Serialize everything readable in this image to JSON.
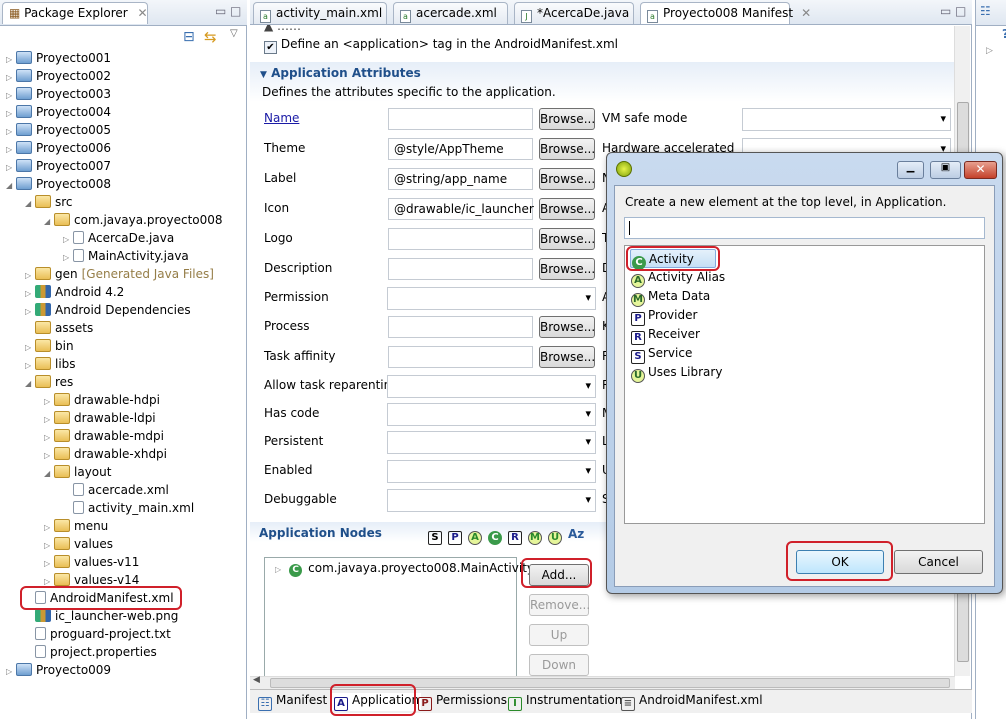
{
  "explorer": {
    "title": "Package Explorer",
    "items": [
      {
        "label": "Proyecto001",
        "level": 0,
        "icon": "project-warning",
        "arrow": "collapsed"
      },
      {
        "label": "Proyecto002",
        "level": 0,
        "icon": "project-warning",
        "arrow": "collapsed"
      },
      {
        "label": "Proyecto003",
        "level": 0,
        "icon": "project-warning",
        "arrow": "collapsed"
      },
      {
        "label": "Proyecto004",
        "level": 0,
        "icon": "project-warning",
        "arrow": "collapsed"
      },
      {
        "label": "Proyecto005",
        "level": 0,
        "icon": "project-warning",
        "arrow": "collapsed"
      },
      {
        "label": "Proyecto006",
        "level": 0,
        "icon": "project-warning",
        "arrow": "collapsed"
      },
      {
        "label": "Proyecto007",
        "level": 0,
        "icon": "project-warning",
        "arrow": "collapsed"
      },
      {
        "label": "Proyecto008",
        "level": 0,
        "icon": "project",
        "arrow": "expanded"
      },
      {
        "label": "src",
        "level": 1,
        "icon": "folder",
        "arrow": "expanded"
      },
      {
        "label": "com.javaya.proyecto008",
        "level": 2,
        "icon": "package",
        "arrow": "expanded"
      },
      {
        "label": "AcercaDe.java",
        "level": 3,
        "icon": "java-file",
        "arrow": "collapsed"
      },
      {
        "label": "MainActivity.java",
        "level": 3,
        "icon": "java-file",
        "arrow": "collapsed"
      },
      {
        "label": "gen",
        "suffix": "[Generated Java Files]",
        "level": 1,
        "icon": "folder",
        "arrow": "collapsed"
      },
      {
        "label": "Android 4.2",
        "level": 1,
        "icon": "library",
        "arrow": "collapsed"
      },
      {
        "label": "Android Dependencies",
        "level": 1,
        "icon": "library",
        "arrow": "collapsed"
      },
      {
        "label": "assets",
        "level": 1,
        "icon": "folder",
        "arrow": ""
      },
      {
        "label": "bin",
        "level": 1,
        "icon": "folder",
        "arrow": "collapsed"
      },
      {
        "label": "libs",
        "level": 1,
        "icon": "folder",
        "arrow": "collapsed"
      },
      {
        "label": "res",
        "level": 1,
        "icon": "folder",
        "arrow": "expanded"
      },
      {
        "label": "drawable-hdpi",
        "level": 2,
        "icon": "folder",
        "arrow": "collapsed"
      },
      {
        "label": "drawable-ldpi",
        "level": 2,
        "icon": "folder",
        "arrow": "collapsed"
      },
      {
        "label": "drawable-mdpi",
        "level": 2,
        "icon": "folder",
        "arrow": "collapsed"
      },
      {
        "label": "drawable-xhdpi",
        "level": 2,
        "icon": "folder",
        "arrow": "collapsed"
      },
      {
        "label": "layout",
        "level": 2,
        "icon": "folder",
        "arrow": "expanded"
      },
      {
        "label": "acercade.xml",
        "level": 3,
        "icon": "xml-file",
        "arrow": ""
      },
      {
        "label": "activity_main.xml",
        "level": 3,
        "icon": "xml-file",
        "arrow": ""
      },
      {
        "label": "menu",
        "level": 2,
        "icon": "folder",
        "arrow": "collapsed"
      },
      {
        "label": "values",
        "level": 2,
        "icon": "folder",
        "arrow": "collapsed"
      },
      {
        "label": "values-v11",
        "level": 2,
        "icon": "folder",
        "arrow": "collapsed"
      },
      {
        "label": "values-v14",
        "level": 2,
        "icon": "folder",
        "arrow": "collapsed"
      },
      {
        "label": "AndroidManifest.xml",
        "level": 1,
        "icon": "xml-file",
        "arrow": "",
        "highlighted": true
      },
      {
        "label": "ic_launcher-web.png",
        "level": 1,
        "icon": "image-file",
        "arrow": ""
      },
      {
        "label": "proguard-project.txt",
        "level": 1,
        "icon": "text-file",
        "arrow": ""
      },
      {
        "label": "project.properties",
        "level": 1,
        "icon": "text-file",
        "arrow": ""
      },
      {
        "label": "Proyecto009",
        "level": 0,
        "icon": "project-warning",
        "arrow": "collapsed"
      }
    ]
  },
  "editor": {
    "tabs": [
      {
        "label": "activity_main.xml"
      },
      {
        "label": "acercade.xml"
      },
      {
        "label": "*AcercaDe.java"
      },
      {
        "label": "Proyecto008 Manifest",
        "active": true
      }
    ],
    "define_checkbox": {
      "label": "Define an <application> tag in the AndroidManifest.xml",
      "checked": true
    },
    "section_title": "Application Attributes",
    "section_desc": "Defines the attributes specific to the application.",
    "fields": [
      {
        "label": "Name",
        "value": "",
        "type": "text",
        "link": true
      },
      {
        "label": "Theme",
        "value": "@style/AppTheme",
        "type": "text"
      },
      {
        "label": "Label",
        "value": "@string/app_name",
        "type": "text"
      },
      {
        "label": "Icon",
        "value": "@drawable/ic_launcher",
        "type": "text"
      },
      {
        "label": "Logo",
        "value": "",
        "type": "text"
      },
      {
        "label": "Description",
        "value": "",
        "type": "text"
      },
      {
        "label": "Permission",
        "value": "",
        "type": "select"
      },
      {
        "label": "Process",
        "value": "",
        "type": "text"
      },
      {
        "label": "Task affinity",
        "value": "",
        "type": "text"
      },
      {
        "label": "Allow task reparenting",
        "value": "",
        "type": "select"
      },
      {
        "label": "Has code",
        "value": "",
        "type": "select"
      },
      {
        "label": "Persistent",
        "value": "",
        "type": "select"
      },
      {
        "label": "Enabled",
        "value": "",
        "type": "select"
      },
      {
        "label": "Debuggable",
        "value": "",
        "type": "select"
      }
    ],
    "browse_label": "Browse...",
    "right_fields": [
      "VM safe mode",
      "Hardware accelerated"
    ],
    "right_clipped": [
      "N",
      "A",
      "T",
      "D",
      "A",
      "K",
      "R",
      "R",
      "M",
      "L",
      "U",
      "S"
    ],
    "nodes_title": "Application Nodes",
    "node_filters": [
      "S",
      "P",
      "A",
      "C",
      "R",
      "M",
      "U",
      "Az"
    ],
    "nodes": [
      {
        "label": "com.javaya.proyecto008.MainActivity"
      }
    ],
    "buttons": {
      "add": "Add...",
      "remove": "Remove...",
      "up": "Up",
      "down": "Down"
    },
    "bottom_tabs": [
      {
        "label": "Manifest"
      },
      {
        "label": "Application",
        "active": true
      },
      {
        "label": "Permissions"
      },
      {
        "label": "Instrumentation"
      },
      {
        "label": "AndroidManifest.xml"
      }
    ]
  },
  "dialog": {
    "message": "Create a new element at the top level, in Application.",
    "filter_value": "",
    "items": [
      {
        "label": "Activity",
        "badge": "C",
        "selected": true
      },
      {
        "label": "Activity Alias",
        "badge": "A"
      },
      {
        "label": "Meta Data",
        "badge": "M"
      },
      {
        "label": "Provider",
        "badge": "P"
      },
      {
        "label": "Receiver",
        "badge": "R"
      },
      {
        "label": "Service",
        "badge": "S"
      },
      {
        "label": "Uses Library",
        "badge": "U"
      }
    ],
    "ok": "OK",
    "cancel": "Cancel"
  },
  "colors": {
    "highlight": "#d0202a",
    "section_title": "#1f4f8a",
    "selection": "#cde4f7"
  }
}
